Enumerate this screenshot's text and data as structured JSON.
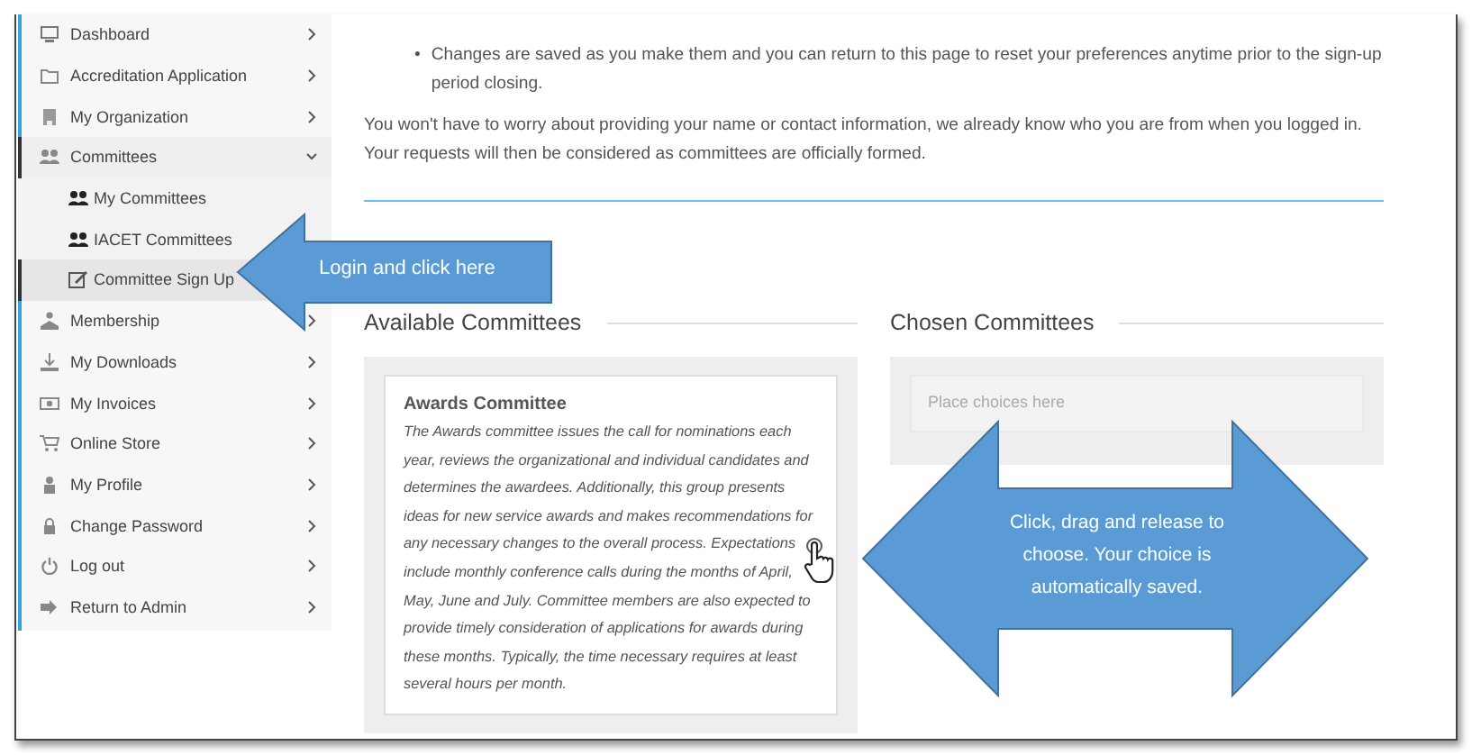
{
  "sidebar": {
    "items": [
      {
        "label": "Dashboard",
        "selected": false
      },
      {
        "label": "Accreditation Application",
        "selected": false
      },
      {
        "label": "My Organization",
        "selected": false
      },
      {
        "label": "Committees",
        "selected": false,
        "expanded": true,
        "children": [
          {
            "label": "My Committees",
            "selected": false
          },
          {
            "label": "IACET Committees",
            "selected": false
          },
          {
            "label": "Committee Sign Up",
            "selected": true
          }
        ]
      },
      {
        "label": "Membership",
        "selected": false
      },
      {
        "label": "My Downloads",
        "selected": false
      },
      {
        "label": "My Invoices",
        "selected": false
      },
      {
        "label": "Online Store",
        "selected": false
      },
      {
        "label": "My Profile",
        "selected": false
      },
      {
        "label": "Change Password",
        "selected": false
      },
      {
        "label": "Log out",
        "selected": false
      },
      {
        "label": "Return to Admin",
        "selected": false
      }
    ]
  },
  "content": {
    "bullets": [
      {
        "marker": "•",
        "text": "Changes are saved as you make them and you can return to this page to reset your preferences anytime prior to the sign-up period closing."
      }
    ],
    "paragraph": "You won't have to worry about providing your name or contact information, we already know who you are from when you logged in. Your requests will then be considered as committees are officially formed.",
    "available": {
      "heading": "Available Committees",
      "cards": [
        {
          "title": "Awards Committee",
          "description": "The Awards committee issues the call for nominations each year, reviews the organizational and individual candidates and determines the awardees. Additionally, this group presents ideas for new service awards and makes recommendations for any necessary changes to the overall process. Expectations include monthly conference calls during the months of April, May, June and July. Committee members are also expected to provide timely consideration of applications for awards during these months. Typically, the time necessary requires at least several hours per month."
        }
      ]
    },
    "chosen": {
      "heading": "Chosen Committees",
      "placeholder": "Place choices here"
    }
  },
  "callouts": [
    {
      "kind": "left",
      "text": "Login and click here"
    },
    {
      "kind": "double",
      "text": "Click, drag and release to choose. Your choice is automatically saved."
    }
  ]
}
